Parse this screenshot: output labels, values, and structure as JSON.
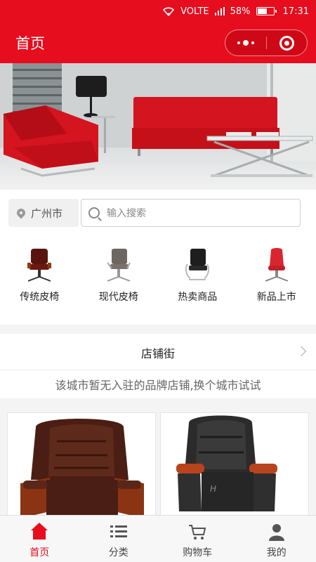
{
  "status_bar": {
    "network": "VOLTE",
    "battery": "58%",
    "battery_level": 0.58,
    "time": "17:31"
  },
  "header": {
    "title": "首页",
    "more_icon": "more-dots-icon",
    "close_icon": "target-icon"
  },
  "banner": {
    "description_icon": "sofa-banner-image"
  },
  "search": {
    "city": "广州市",
    "placeholder": "输入搜索"
  },
  "categories": [
    {
      "label": "传统皮椅",
      "icon": "chair-icon"
    },
    {
      "label": "现代皮椅",
      "icon": "chair-icon"
    },
    {
      "label": "热卖商品",
      "icon": "chair-icon"
    },
    {
      "label": "新品上市",
      "icon": "chair-icon"
    }
  ],
  "shop_street": {
    "title": "店铺街",
    "empty_message": "该城市暂无入驻的品牌店铺,换个城市试试"
  },
  "products": [
    {
      "image": "brown-leather-office-chair"
    },
    {
      "image": "black-leather-office-chair"
    }
  ],
  "tabbar": [
    {
      "label": "首页",
      "icon": "home-icon",
      "active": true
    },
    {
      "label": "分类",
      "icon": "list-icon",
      "active": false
    },
    {
      "label": "购物车",
      "icon": "cart-icon",
      "active": false
    },
    {
      "label": "我的",
      "icon": "user-icon",
      "active": false
    }
  ],
  "colors": {
    "brand_red": "#e60d1e",
    "banner_sofa": "#d4141f"
  }
}
